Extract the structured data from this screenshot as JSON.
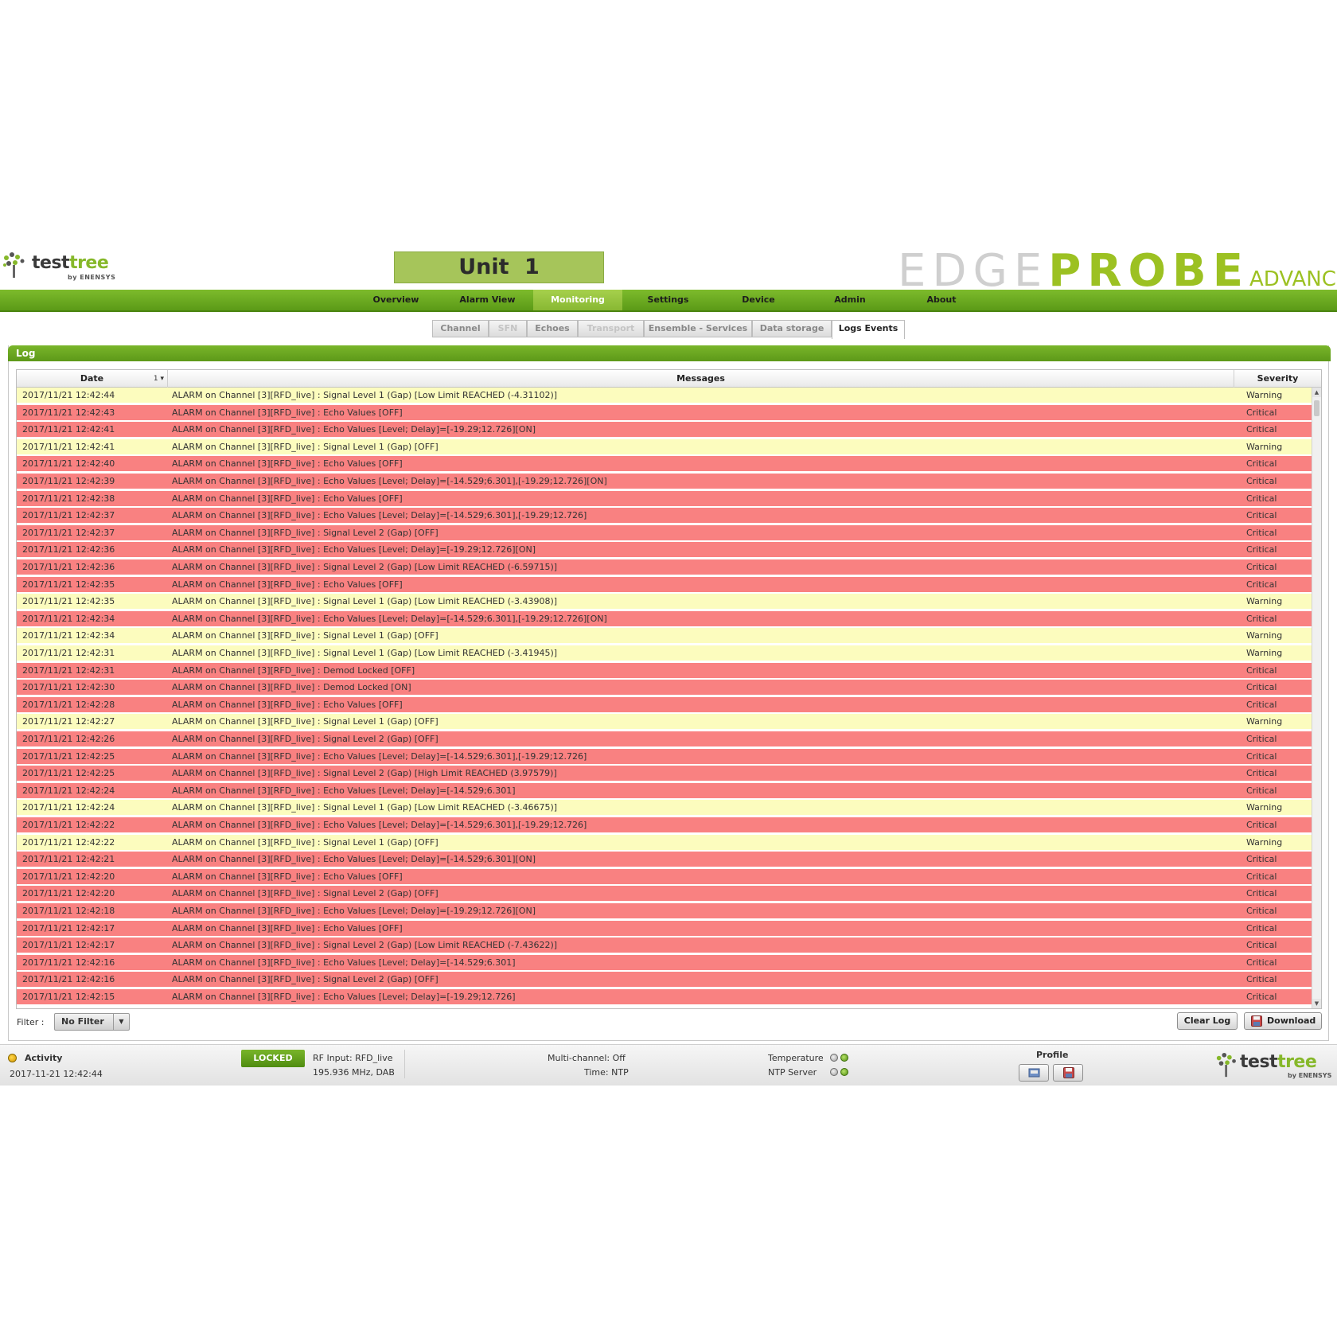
{
  "header": {
    "logo_word_1": "test",
    "logo_word_2": "tree",
    "logo_sub": "by ENENSYS",
    "unit_title": "Unit 1",
    "brand_edge": "EDGE",
    "brand_probe": "PROBE",
    "brand_advanced": "ADVANCED"
  },
  "nav": {
    "items": [
      "Overview",
      "Alarm View",
      "Monitoring",
      "Settings",
      "Device",
      "Admin",
      "About"
    ],
    "active": "Monitoring"
  },
  "subtabs": {
    "items": [
      "Channel",
      "SFN",
      "Echoes",
      "Transport",
      "Ensemble - Services",
      "Data storage",
      "Logs Events"
    ],
    "disabled": [
      "SFN",
      "Transport"
    ],
    "active": "Logs Events"
  },
  "panel": {
    "title": "Log",
    "columns": {
      "date": "Date",
      "sort_indicator": "1 ▾",
      "messages": "Messages",
      "severity": "Severity"
    },
    "rows": [
      [
        "2017/11/21 12:42:44",
        "ALARM on Channel [3][RFD_live] : Signal Level 1 (Gap) [Low Limit REACHED (-4.31102)]",
        "Warning"
      ],
      [
        "2017/11/21 12:42:43",
        "ALARM on Channel [3][RFD_live] : Echo Values [OFF]",
        "Critical"
      ],
      [
        "2017/11/21 12:42:41",
        "ALARM on Channel [3][RFD_live] : Echo Values [Level; Delay]=[-19.29;12.726][ON]",
        "Critical"
      ],
      [
        "2017/11/21 12:42:41",
        "ALARM on Channel [3][RFD_live] : Signal Level 1 (Gap) [OFF]",
        "Warning"
      ],
      [
        "2017/11/21 12:42:40",
        "ALARM on Channel [3][RFD_live] : Echo Values [OFF]",
        "Critical"
      ],
      [
        "2017/11/21 12:42:39",
        "ALARM on Channel [3][RFD_live] : Echo Values [Level; Delay]=[-14.529;6.301],[-19.29;12.726][ON]",
        "Critical"
      ],
      [
        "2017/11/21 12:42:38",
        "ALARM on Channel [3][RFD_live] : Echo Values [OFF]",
        "Critical"
      ],
      [
        "2017/11/21 12:42:37",
        "ALARM on Channel [3][RFD_live] : Echo Values [Level; Delay]=[-14.529;6.301],[-19.29;12.726]",
        "Critical"
      ],
      [
        "2017/11/21 12:42:37",
        "ALARM on Channel [3][RFD_live] : Signal Level 2 (Gap) [OFF]",
        "Critical"
      ],
      [
        "2017/11/21 12:42:36",
        "ALARM on Channel [3][RFD_live] : Echo Values [Level; Delay]=[-19.29;12.726][ON]",
        "Critical"
      ],
      [
        "2017/11/21 12:42:36",
        "ALARM on Channel [3][RFD_live] : Signal Level 2 (Gap) [Low Limit REACHED (-6.59715)]",
        "Critical"
      ],
      [
        "2017/11/21 12:42:35",
        "ALARM on Channel [3][RFD_live] : Echo Values [OFF]",
        "Critical"
      ],
      [
        "2017/11/21 12:42:35",
        "ALARM on Channel [3][RFD_live] : Signal Level 1 (Gap) [Low Limit REACHED (-3.43908)]",
        "Warning"
      ],
      [
        "2017/11/21 12:42:34",
        "ALARM on Channel [3][RFD_live] : Echo Values [Level; Delay]=[-14.529;6.301],[-19.29;12.726][ON]",
        "Critical"
      ],
      [
        "2017/11/21 12:42:34",
        "ALARM on Channel [3][RFD_live] : Signal Level 1 (Gap) [OFF]",
        "Warning"
      ],
      [
        "2017/11/21 12:42:31",
        "ALARM on Channel [3][RFD_live] : Signal Level 1 (Gap) [Low Limit REACHED (-3.41945)]",
        "Warning"
      ],
      [
        "2017/11/21 12:42:31",
        "ALARM on Channel [3][RFD_live] : Demod Locked [OFF]",
        "Critical"
      ],
      [
        "2017/11/21 12:42:30",
        "ALARM on Channel [3][RFD_live] : Demod Locked [ON]",
        "Critical"
      ],
      [
        "2017/11/21 12:42:28",
        "ALARM on Channel [3][RFD_live] : Echo Values [OFF]",
        "Critical"
      ],
      [
        "2017/11/21 12:42:27",
        "ALARM on Channel [3][RFD_live] : Signal Level 1 (Gap) [OFF]",
        "Warning"
      ],
      [
        "2017/11/21 12:42:26",
        "ALARM on Channel [3][RFD_live] : Signal Level 2 (Gap) [OFF]",
        "Critical"
      ],
      [
        "2017/11/21 12:42:25",
        "ALARM on Channel [3][RFD_live] : Echo Values [Level; Delay]=[-14.529;6.301],[-19.29;12.726]",
        "Critical"
      ],
      [
        "2017/11/21 12:42:25",
        "ALARM on Channel [3][RFD_live] : Signal Level 2 (Gap) [High Limit REACHED (3.97579)]",
        "Critical"
      ],
      [
        "2017/11/21 12:42:24",
        "ALARM on Channel [3][RFD_live] : Echo Values [Level; Delay]=[-14.529;6.301]",
        "Critical"
      ],
      [
        "2017/11/21 12:42:24",
        "ALARM on Channel [3][RFD_live] : Signal Level 1 (Gap) [Low Limit REACHED (-3.46675)]",
        "Warning"
      ],
      [
        "2017/11/21 12:42:22",
        "ALARM on Channel [3][RFD_live] : Echo Values [Level; Delay]=[-14.529;6.301],[-19.29;12.726]",
        "Critical"
      ],
      [
        "2017/11/21 12:42:22",
        "ALARM on Channel [3][RFD_live] : Signal Level 1 (Gap) [OFF]",
        "Warning"
      ],
      [
        "2017/11/21 12:42:21",
        "ALARM on Channel [3][RFD_live] : Echo Values [Level; Delay]=[-14.529;6.301][ON]",
        "Critical"
      ],
      [
        "2017/11/21 12:42:20",
        "ALARM on Channel [3][RFD_live] : Echo Values [OFF]",
        "Critical"
      ],
      [
        "2017/11/21 12:42:20",
        "ALARM on Channel [3][RFD_live] : Signal Level 2 (Gap) [OFF]",
        "Critical"
      ],
      [
        "2017/11/21 12:42:18",
        "ALARM on Channel [3][RFD_live] : Echo Values [Level; Delay]=[-19.29;12.726][ON]",
        "Critical"
      ],
      [
        "2017/11/21 12:42:17",
        "ALARM on Channel [3][RFD_live] : Echo Values [OFF]",
        "Critical"
      ],
      [
        "2017/11/21 12:42:17",
        "ALARM on Channel [3][RFD_live] : Signal Level 2 (Gap) [Low Limit REACHED (-7.43622)]",
        "Critical"
      ],
      [
        "2017/11/21 12:42:16",
        "ALARM on Channel [3][RFD_live] : Echo Values [Level; Delay]=[-14.529;6.301]",
        "Critical"
      ],
      [
        "2017/11/21 12:42:16",
        "ALARM on Channel [3][RFD_live] : Signal Level 2 (Gap) [OFF]",
        "Critical"
      ],
      [
        "2017/11/21 12:42:15",
        "ALARM on Channel [3][RFD_live] : Echo Values [Level; Delay]=[-19.29;12.726]",
        "Critical"
      ]
    ],
    "filter_label": "Filter :",
    "filter_value": "No Filter",
    "clear_log_label": "Clear Log",
    "download_label": "Download"
  },
  "status": {
    "activity_label": "Activity",
    "timestamp": "2017-11-21 12:42:44",
    "locked_label": "LOCKED",
    "rf_input": "RF Input: RFD_live",
    "rf_freq": "195.936 MHz, DAB",
    "multichannel": "Multi-channel: Off",
    "time_source": "Time: NTP",
    "temperature_label": "Temperature",
    "ntp_label": "NTP Server",
    "profile_label": "Profile"
  },
  "colors": {
    "brand_green": "#7dbb2c",
    "warning_row": "#fcfcbe",
    "critical_row": "#f98181",
    "unit_box": "#a6c55a"
  }
}
